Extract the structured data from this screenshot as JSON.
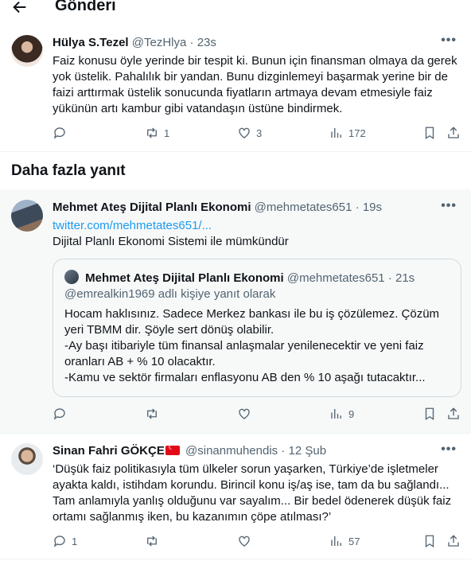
{
  "header": {
    "title": "Gönderi"
  },
  "main_tweet": {
    "name": "Hülya S.Tezel",
    "handle": "@TezHlya",
    "time": "23s",
    "text": "Faiz konusu öyle yerinde bir tespit ki. Bunun için finansman olmaya da gerek yok üstelik. Pahalılık bir yandan. Bunu dizginlemeyi başarmak yerine bir de faizi arttırmak üstelik sonucunda fiyatların artmaya devam etmesiyle faiz yükünün artı kambur gibi vatandaşın üstüne bindirmek.",
    "retweets": "1",
    "likes": "3",
    "views": "172"
  },
  "section": {
    "title": "Daha fazla yanıt"
  },
  "reply1": {
    "name": "Mehmet Ateş Dijital Planlı Ekonomi",
    "handle": "@mehmetates651",
    "time": "19s",
    "link": "twitter.com/mehmetates651/...",
    "text": "Dijital Planlı Ekonomi Sistemi ile mümkündür",
    "views": "9",
    "quote": {
      "name": "Mehmet Ateş Dijital Planlı Ekonomi",
      "handle": "@mehmetates651",
      "time": "21s",
      "reply_to": "@emrealkin1969 adlı kişiye yanıt olarak",
      "text": "Hocam haklısınız. Sadece Merkez bankası ile bu iş çözülemez. Çözüm yeri TBMM dir. Şöyle sert dönüş olabilir.\n-Ay başı itibariyle tüm finansal anlaşmalar yenilenecektir ve yeni faiz oranları AB + % 10 olacaktır.\n-Kamu ve sektör firmaları enflasyonu AB den % 10 aşağı tutacaktır..."
    }
  },
  "reply2": {
    "name": "Sinan Fahri GÖKÇE",
    "handle": "@sinanmuhendis",
    "time": "12 Şub",
    "text": "‘Düşük faiz politikasıyla tüm ülkeler sorun yaşarken, Türkiye’de işletmeler ayakta kaldı, istihdam korundu. Birincil konu iş/aş ise, tam da bu sağlandı... Tam anlamıyla yanlış olduğunu var sayalım... Bir bedel ödenerek düşük faiz ortamı sağlanmış iken, bu kazanımın çöpe atılması?’",
    "replies": "1",
    "views": "57"
  },
  "separator": "·",
  "colors": {
    "link": "#1d9bf0",
    "muted": "#536471",
    "text": "#0f1419",
    "flag": "#e30a17"
  }
}
